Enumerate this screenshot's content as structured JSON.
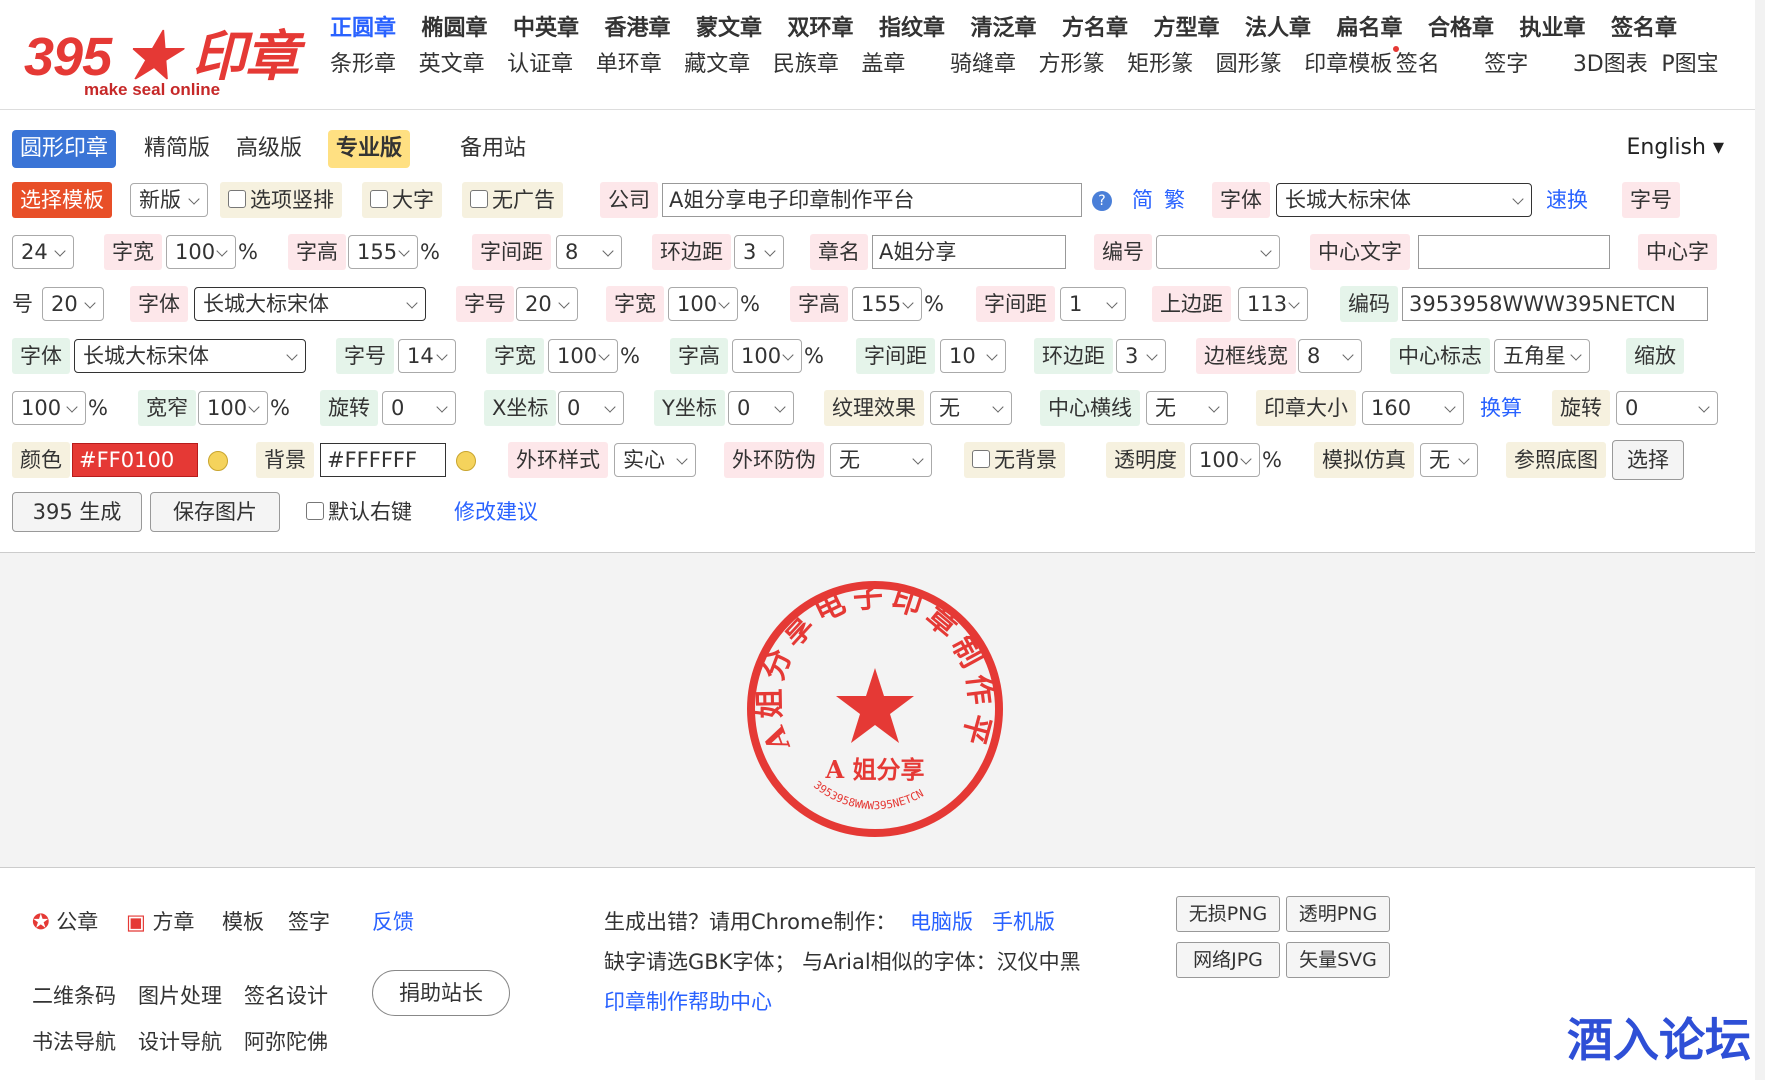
{
  "logo": {
    "title": "395 ★ 印章",
    "subtitle": "make seal online"
  },
  "nav": {
    "row1": [
      "正圆章",
      "椭圆章",
      "中英章",
      "香港章",
      "蒙文章",
      "双环章",
      "指纹章",
      "清泛章",
      "方名章",
      "方型章",
      "法人章",
      "扁名章",
      "合格章",
      "执业章",
      "签名章"
    ],
    "row2": [
      "条形章",
      "英文章",
      "认证章",
      "单环章",
      "藏文章",
      "民族章",
      "盖章",
      "骑缝章",
      "方形篆",
      "矩形篆",
      "圆形篆",
      "印章模板",
      "签名",
      "签字",
      "3D图表",
      "P图宝"
    ]
  },
  "tabs": {
    "round": "圆形印章",
    "simple": "精简版",
    "advanced": "高级版",
    "pro": "专业版",
    "backup": "备用站",
    "lang": "English"
  },
  "row1": {
    "choose_tpl": "选择模板",
    "version": "新版",
    "opt_vertical": "选项竖排",
    "big": "大字",
    "no_ad": "无广告",
    "company_label": "公司",
    "company_value": "A姐分享电子印章制作平台",
    "simp": "简",
    "trad": "繁",
    "font_label": "字体",
    "font_value": "长城大标宋体",
    "quick": "速换",
    "size_label": "字号"
  },
  "row2": {
    "size_value": "24",
    "width_label": "字宽",
    "width_value": "100",
    "pct": "%",
    "height_label": "字高",
    "height_value": "155",
    "spacing_label": "字间距",
    "spacing_value": "8",
    "margin_label": "环边距",
    "margin_value": "3",
    "name_label": "章名",
    "name_value": "A姐分享",
    "num_label": "编号",
    "num_value": "",
    "center_label": "中心文字",
    "center_value": "",
    "center_font_label": "中心字"
  },
  "row3": {
    "hao": "号",
    "cs_value": "20",
    "font_label": "字体",
    "font_value": "长城大标宋体",
    "size_label": "字号",
    "size_value": "20",
    "width_label": "字宽",
    "width_value": "100",
    "height_label": "字高",
    "height_value": "155",
    "spacing_label": "字间距",
    "spacing_value": "1",
    "top_label": "上边距",
    "top_value": "113",
    "code_label": "编码",
    "code_value": "3953958WWW395NETCN"
  },
  "row4": {
    "font_label": "字体",
    "font_value": "长城大标宋体",
    "size_label": "字号",
    "size_value": "14",
    "width_label": "字宽",
    "width_value": "100",
    "height_label": "字高",
    "height_value": "100",
    "spacing_label": "字间距",
    "spacing_value": "10",
    "margin_label": "环边距",
    "margin_value": "3",
    "border_label": "边框线宽",
    "border_value": "8",
    "logo_label": "中心标志",
    "logo_value": "五角星",
    "zoom_label": "缩放"
  },
  "row5": {
    "zoom_value": "100",
    "narrow_label": "宽窄",
    "narrow_value": "100",
    "rotate_label": "旋转",
    "rotate_value": "0",
    "x_label": "X坐标",
    "x_value": "0",
    "y_label": "Y坐标",
    "y_value": "0",
    "texture_label": "纹理效果",
    "texture_value": "无",
    "hline_label": "中心横线",
    "hline_value": "无",
    "sealsize_label": "印章大小",
    "sealsize_value": "160",
    "convert": "换算",
    "rotate2_label": "旋转",
    "rotate2_value": "0"
  },
  "row6": {
    "color_label": "颜色",
    "color_value": "#FF0100",
    "bg_label": "背景",
    "bg_value": "#FFFFFF",
    "ring_label": "外环样式",
    "ring_value": "实心",
    "anti_label": "外环防伪",
    "anti_value": "无",
    "nobg": "无背景",
    "opacity_label": "透明度",
    "opacity_value": "100",
    "sim_label": "模拟仿真",
    "sim_value": "无",
    "ref_label": "参照底图",
    "ref_btn": "选择"
  },
  "row7": {
    "generate": "395 生成",
    "save": "保存图片",
    "right_key": "默认右键",
    "suggest": "修改建议"
  },
  "seal": {
    "arc_text": "A姐分享电子印章制作平台",
    "name": "A 姐分享",
    "code": "3953958WWW395NETCN",
    "color": "#e53935"
  },
  "footer": {
    "gz": "公章",
    "fz": "方章",
    "tpl": "模板",
    "sign": "签字",
    "feedback": "反馈",
    "qr": "二维条码",
    "img": "图片处理",
    "sigdesign": "签名设计",
    "donate": "捐助站长",
    "calli": "书法导航",
    "design": "设计导航",
    "amituofo": "阿弥陀佛",
    "err": "生成出错？请用Chrome制作：",
    "pc": "电脑版",
    "mobile": "手机版",
    "gbk": "缺字请选GBK字体；  与Arial相似的字体：汉仪中黑",
    "help": "印章制作帮助中心",
    "png": "无损PNG",
    "tpng": "透明PNG",
    "jpg": "网络JPG",
    "svg": "矢量SVG"
  },
  "watermark": "酒入论坛"
}
